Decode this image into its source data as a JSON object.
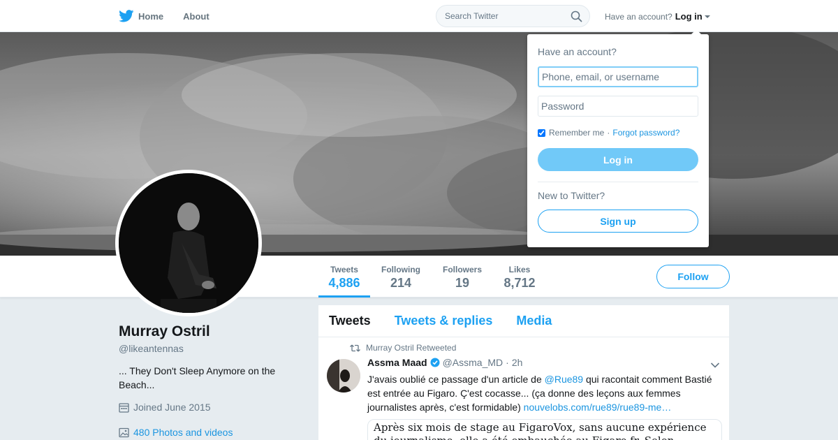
{
  "nav": {
    "home_label": "Home",
    "about_label": "About",
    "search_placeholder": "Search Twitter",
    "have_account": "Have an account?",
    "login_label": "Log in"
  },
  "profile": {
    "name": "Murray Ostril",
    "handle": "@likeantennas",
    "bio": "... They Don't Sleep Anymore on the Beach...",
    "joined": "Joined June 2015",
    "photos": "480 Photos and videos"
  },
  "stats": [
    {
      "label": "Tweets",
      "value": "4,886"
    },
    {
      "label": "Following",
      "value": "214"
    },
    {
      "label": "Followers",
      "value": "19"
    },
    {
      "label": "Likes",
      "value": "8,712"
    }
  ],
  "follow_label": "Follow",
  "timeline": {
    "tabs": [
      "Tweets",
      "Tweets & replies",
      "Media"
    ],
    "tweet": {
      "retweeted_by": "Murray Ostril Retweeted",
      "author_name": "Assma Maad",
      "author_handle": "@Assma_MD",
      "separator": "·",
      "time": "2h",
      "text_before": "J'avais oublié ce passage d'un article de ",
      "mention": "@Rue89",
      "text_after": " qui racontait comment Bastié est entrée au Figaro. Ç'est cocasse... (ça donne des leçons aux femmes journalistes après, c'est formidable) ",
      "link": "nouvelobs.com/rue89/rue89-me…",
      "card_text": "Après six mois de stage au FigaroVox, sans aucune expérience du journalisme, elle a été embauchée au Figaro.fr. Selon plusieurs sources"
    }
  },
  "login_dropdown": {
    "title": "Have an account?",
    "username_placeholder": "Phone, email, or username",
    "password_placeholder": "Password",
    "remember_label": "Remember me",
    "separator": "·",
    "forgot_label": "Forgot password?",
    "login_button": "Log in",
    "new_label": "New to Twitter?",
    "signup_button": "Sign up"
  },
  "colors": {
    "brand_blue": "#1da1f2",
    "link_blue": "#1b95e0",
    "background": "#e6ecf0"
  }
}
